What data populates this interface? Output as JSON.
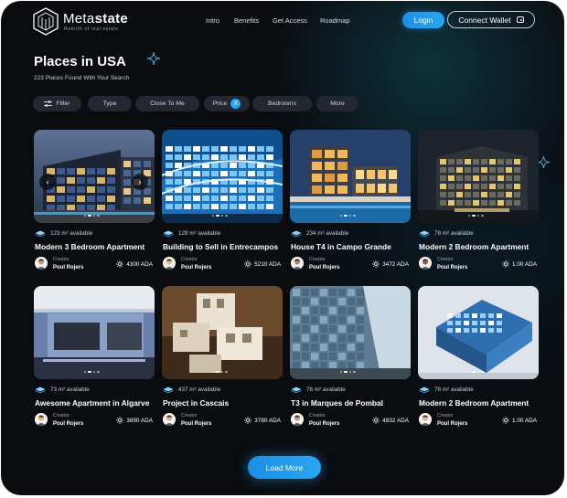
{
  "header": {
    "brand_light": "Meta",
    "brand_bold": "state",
    "tagline": "Rebirth of real estate",
    "nav": [
      "Intro",
      "Benefits",
      "Get Access",
      "Roadmap"
    ],
    "login_label": "Login",
    "wallet_label": "Connect Wallet"
  },
  "page": {
    "title": "Places in USA",
    "subtitle": "223 Places Found With Your Search"
  },
  "filters": [
    {
      "label": "Filter",
      "icon": "sliders-icon"
    },
    {
      "label": "Type"
    },
    {
      "label": "Close To Me"
    },
    {
      "label": "Price",
      "badge": "X"
    },
    {
      "label": "Bedrooms"
    },
    {
      "label": "More"
    }
  ],
  "cards": [
    {
      "area": "123 m² available",
      "title": "Modern 3 Bedroom Apartment",
      "creator_label": "Creator",
      "creator": "Poul Rojers",
      "price": "4300 ADA",
      "theme": "night-glass"
    },
    {
      "area": "128 m² available",
      "title": "Building to Sell in Entrecampos",
      "creator_label": "Creator",
      "creator": "Poul Rojers",
      "price": "5210 ADA",
      "theme": "blue-curve"
    },
    {
      "area": "234 m² available",
      "title": "House T4 in Campo Grande",
      "creator_label": "Creator",
      "creator": "Poul Rojers",
      "price": "3472 ADA",
      "theme": "night-villa"
    },
    {
      "area": "78 m² available",
      "title": "Modern 2 Bedroom Apartment",
      "creator_label": "Creator",
      "creator": "Poul Rojers",
      "price": "1.00 ADA",
      "theme": "night-cube"
    },
    {
      "area": "73 m² available",
      "title": "Awesome Apartment in Algarve",
      "creator_label": "Creator",
      "creator": "Poul Rojers",
      "price": "3890 ADA",
      "theme": "dusk-terrace"
    },
    {
      "area": "437 m² available",
      "title": "Project in Cascais",
      "creator_label": "Creator",
      "creator": "Poul Rojers",
      "price": "3780 ADA",
      "theme": "paper-model"
    },
    {
      "area": "76 m² available",
      "title": "T3 in Marques de Pombal",
      "creator_label": "Creator",
      "creator": "Poul Rojers",
      "price": "4832 ADA",
      "theme": "glass-facade"
    },
    {
      "area": "78 m² available",
      "title": "Modern 2 Bedroom Apartment",
      "creator_label": "Creator",
      "creator": "Poul Rojers",
      "price": "1.00 ADA",
      "theme": "blue-render"
    }
  ],
  "load_more_label": "Load More",
  "colors": {
    "accent": "#2aa6f2",
    "background": "#0a0c10",
    "chip": "#232830"
  }
}
